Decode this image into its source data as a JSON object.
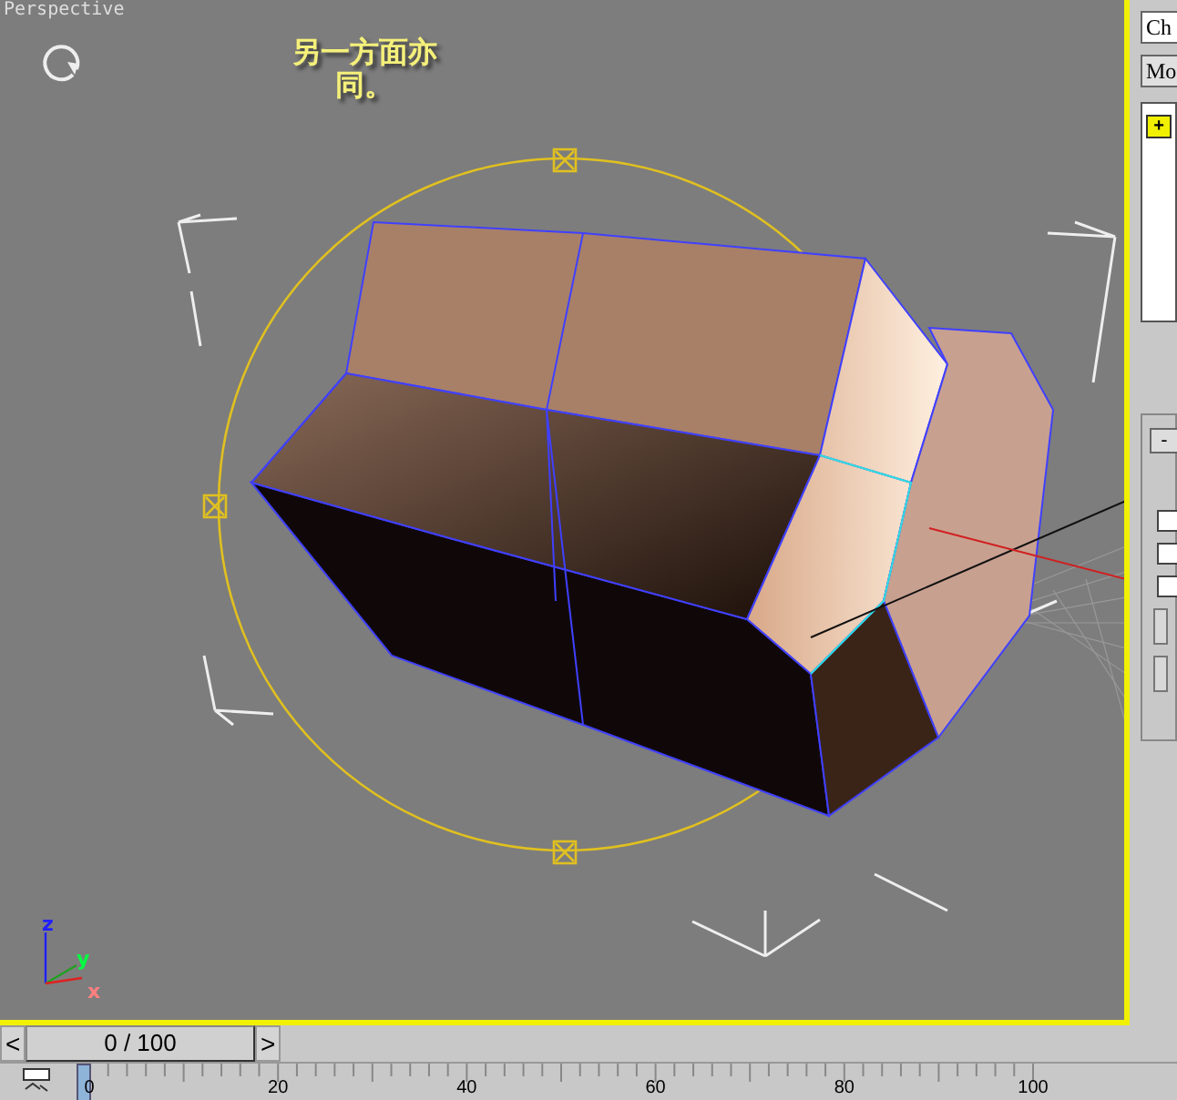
{
  "viewport": {
    "label": "Perspective",
    "caption": "另一方面亦同。",
    "axes": [
      {
        "label": "z"
      },
      {
        "label": "y"
      },
      {
        "label": "x"
      }
    ]
  },
  "command_panel": {
    "name_field": {
      "value": "Ch"
    },
    "modifier_dropdown": {
      "value": "Mo"
    },
    "stack_item": {
      "label": "+"
    },
    "rollout": {
      "label": "-"
    },
    "checkboxes": [
      {
        "checked": false
      },
      {
        "checked": false
      },
      {
        "checked": false
      }
    ]
  },
  "time_slider": {
    "prev": "<",
    "position": "0 / 100",
    "next": ">",
    "level": 0
  },
  "track_bar": {
    "ticks": [
      "0",
      "20",
      "40",
      "60",
      "80",
      "100"
    ]
  }
}
